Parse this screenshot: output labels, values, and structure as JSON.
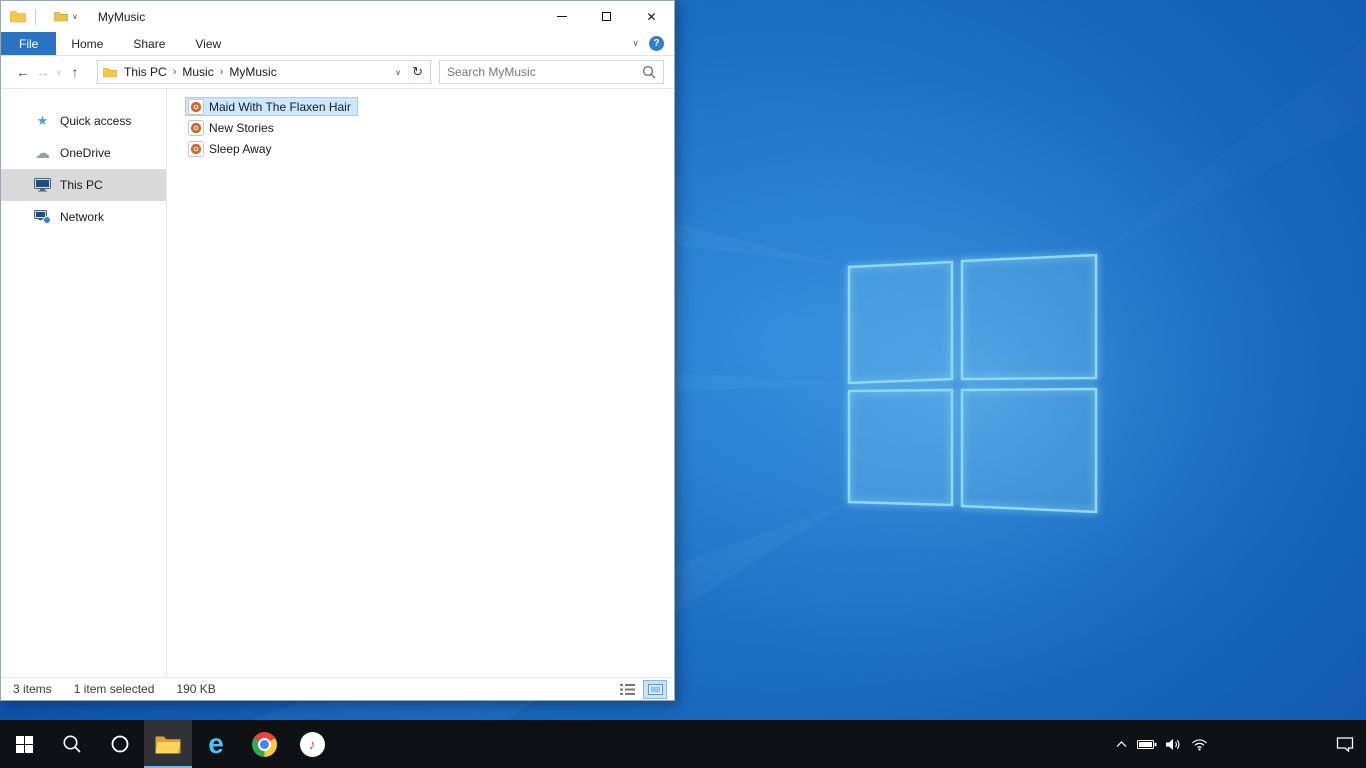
{
  "window": {
    "title": "MyMusic",
    "controls": {
      "minimize": "minimize",
      "maximize": "maximize",
      "close": "✕"
    },
    "ribbon": {
      "tabs": [
        {
          "label": "File",
          "active": true
        },
        {
          "label": "Home",
          "active": false
        },
        {
          "label": "Share",
          "active": false
        },
        {
          "label": "View",
          "active": false
        }
      ],
      "collapse_glyph": "∨",
      "help": "?"
    },
    "nav": {
      "back": "←",
      "forward": "→",
      "history_dropdown": "∨",
      "up": "↑",
      "address_dropdown": "∨",
      "refresh": "↻",
      "crumb_sep": "›"
    },
    "address": {
      "crumbs": [
        "This PC",
        "Music",
        "MyMusic"
      ]
    },
    "search": {
      "placeholder": "Search MyMusic"
    },
    "sidebar": {
      "items": [
        {
          "label": "Quick access",
          "icon": "star-icon",
          "glyph": "★",
          "selected": false
        },
        {
          "label": "OneDrive",
          "icon": "cloud-icon",
          "glyph": "☁",
          "selected": false
        },
        {
          "label": "This PC",
          "icon": "computer-icon",
          "selected": true
        },
        {
          "label": "Network",
          "icon": "network-icon",
          "selected": false
        }
      ]
    },
    "files": [
      {
        "name": "Maid With The Flaxen Hair",
        "icon": "music-file-icon",
        "selected": true
      },
      {
        "name": "New Stories",
        "icon": "music-file-icon",
        "selected": false
      },
      {
        "name": "Sleep Away",
        "icon": "music-file-icon",
        "selected": false
      }
    ],
    "status": {
      "count": "3 items",
      "selection": "1 item selected",
      "size": "190 KB"
    },
    "view_buttons": [
      "details-view",
      "large-icons-view"
    ],
    "active_view": "large-icons-view"
  },
  "taskbar": {
    "apps": [
      "start",
      "search",
      "cortana",
      "file-explorer",
      "internet-explorer",
      "chrome",
      "music"
    ],
    "active_app": "file-explorer",
    "icons": {
      "ie_glyph": "e",
      "music_note": "♪"
    },
    "tray": [
      "show-hidden-icons",
      "battery",
      "speaker",
      "wifi"
    ],
    "action_center": "action-center"
  },
  "colors": {
    "accent": "#0078d7",
    "file_tab": "#2873c2",
    "selection_fill": "#cce8ff",
    "selection_border": "#99d1ff",
    "sidebar_selection": "#d9d9d9",
    "taskbar_bg": "#101115",
    "desktop_blue_light": "#3089dd",
    "desktop_blue_dark": "#0c50a8",
    "logo_stroke": "#8ed9f8"
  }
}
